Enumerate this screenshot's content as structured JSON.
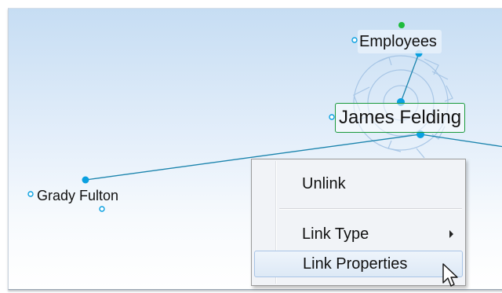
{
  "nodes": {
    "employees": "Employees",
    "james": "James Felding",
    "grady": "Grady Fulton"
  },
  "context_menu": {
    "items": [
      {
        "label": "Unlink",
        "has_submenu": false,
        "highlighted": false
      },
      {
        "label": "Link Type",
        "has_submenu": true,
        "highlighted": false
      },
      {
        "label": "Link Properties",
        "has_submenu": false,
        "highlighted": true
      }
    ]
  },
  "colors": {
    "link": "#1b84ad",
    "handle": "#0aa0e0",
    "top_handle": "#1dbb3c",
    "selection_border": "#1a9a3c"
  }
}
